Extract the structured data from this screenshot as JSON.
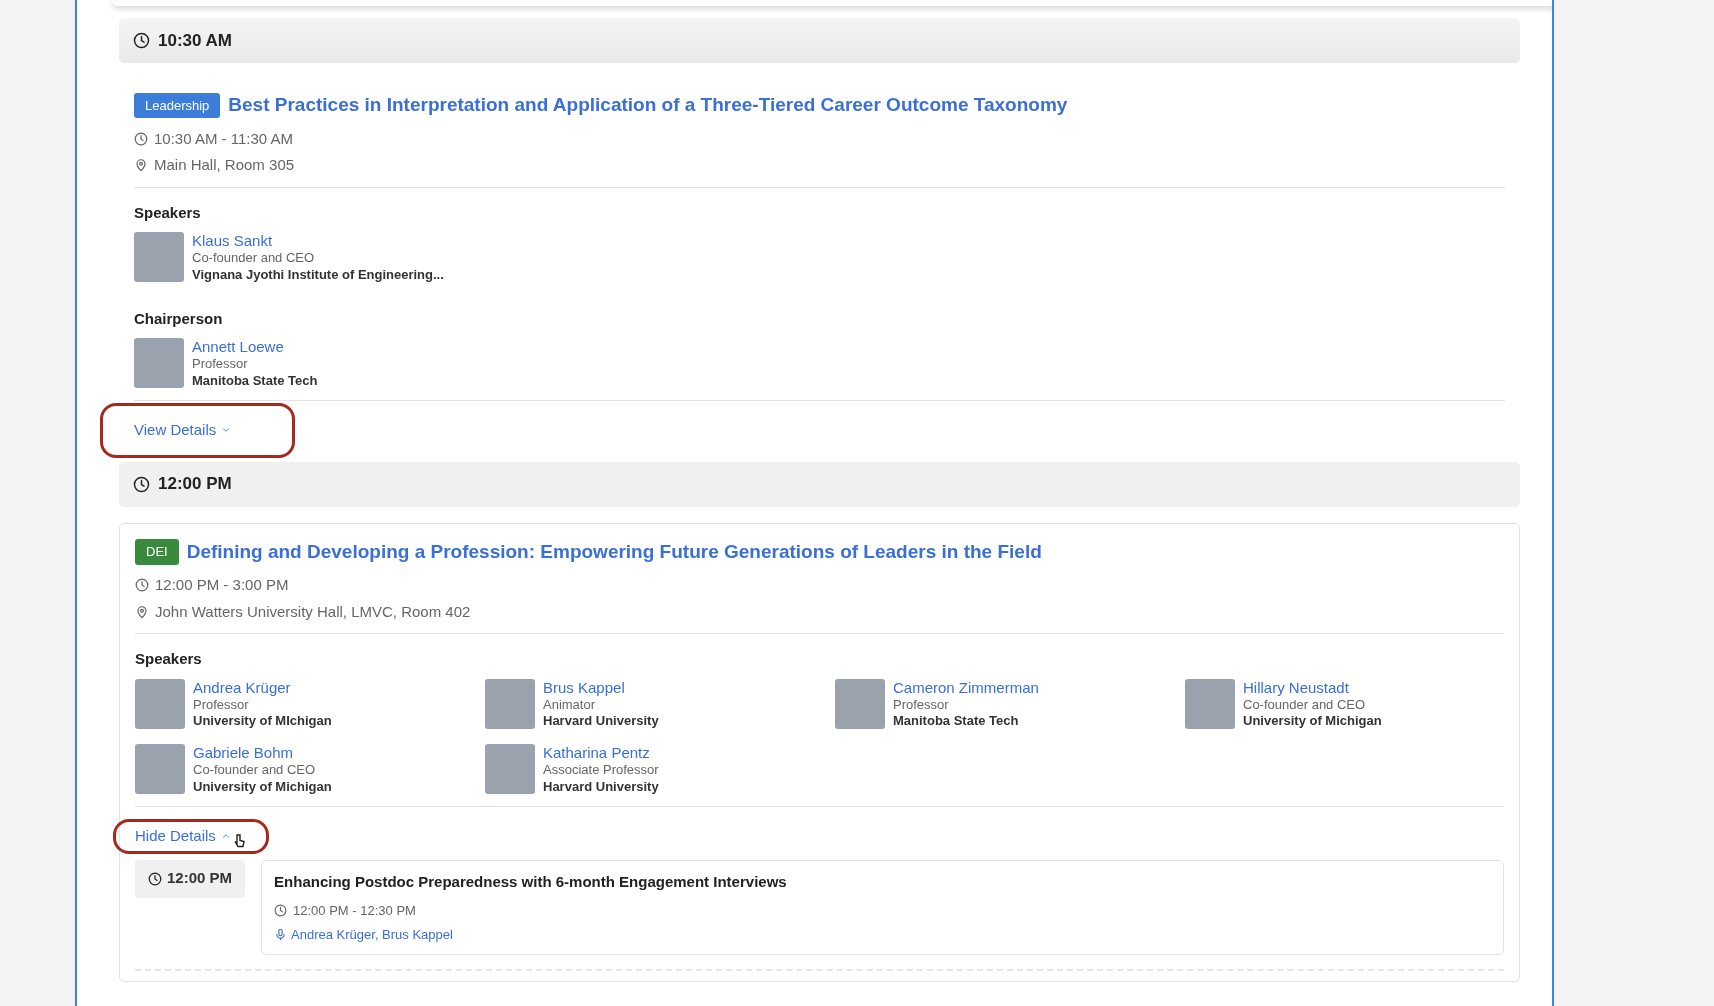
{
  "slots": [
    {
      "time": "10:30 AM",
      "sessions": [
        {
          "tag": "Leadership",
          "color": "#3b7dd8",
          "title": "Best Practices in Interpretation and Application of a Three-Tiered Career Outcome Taxonomy",
          "time": "10:30 AM - 11:30 AM",
          "location": "Main Hall, Room 305",
          "expanded": false,
          "groups": [
            {
              "heading": "Speakers",
              "people": [
                {
                  "name": "Klaus Sankt",
                  "role": "Co-founder and CEO",
                  "org": "Vignana Jyothi Institute of Engineering..."
                }
              ]
            },
            {
              "heading": "Chairperson",
              "people": [
                {
                  "name": "Annett Loewe",
                  "role": "Professor",
                  "org": "Manitoba State Tech"
                }
              ]
            }
          ],
          "toggle": "View Details"
        }
      ]
    },
    {
      "time": "12:00 PM",
      "sessions": [
        {
          "tag": "DEI",
          "color": "#3a8a3e",
          "title": "Defining and Developing a Profession: Empowering Future Generations of Leaders in the Field",
          "time": "12:00 PM - 3:00 PM",
          "location": "John Watters University Hall, LMVC, Room 402",
          "expanded": true,
          "groups": [
            {
              "heading": "Speakers",
              "people": [
                {
                  "name": "Andrea Krüger",
                  "role": "Professor",
                  "org": "University of MIchigan"
                },
                {
                  "name": "Brus Kappel",
                  "role": "Animator",
                  "org": "Harvard University"
                },
                {
                  "name": "Cameron Zimmerman",
                  "role": "Professor",
                  "org": "Manitoba State Tech"
                },
                {
                  "name": "Hillary Neustadt",
                  "role": "Co-founder and CEO",
                  "org": "University of Michigan"
                },
                {
                  "name": "Gabriele Bohm",
                  "role": "Co-founder and CEO",
                  "org": "University of Michigan"
                },
                {
                  "name": "Katharina Pentz",
                  "role": "Associate Professor",
                  "org": "Harvard University"
                }
              ]
            }
          ],
          "toggle": "Hide Details",
          "subsessions": [
            {
              "time": "12:00 PM",
              "title": "Enhancing Postdoc Preparedness with 6-month Engagement Interviews",
              "range": "12:00 PM - 12:30 PM",
              "speakers": "Andrea Krüger, Brus Kappel"
            }
          ]
        }
      ]
    }
  ]
}
